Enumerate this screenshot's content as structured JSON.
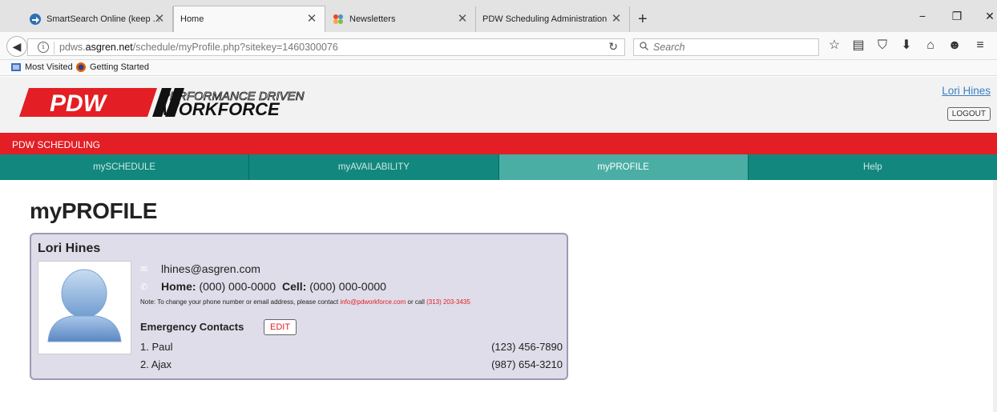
{
  "browser": {
    "tabs": [
      {
        "title": "SmartSearch Online (keep ...",
        "active": false
      },
      {
        "title": "Home",
        "active": true
      },
      {
        "title": "Newsletters",
        "active": false
      },
      {
        "title": "PDW Scheduling Administration",
        "active": false
      }
    ],
    "url_prefix": "pdws.",
    "url_domain": "asgren.net",
    "url_path": "/schedule/myProfile.php?sitekey=1460300076",
    "search_placeholder": "Search",
    "bookmarks": [
      "Most Visited",
      "Getting Started"
    ]
  },
  "header": {
    "logo_text": "PDW",
    "logo_tagline_1": "PERFORMANCE DRIVEN",
    "logo_tagline_2": "WORKFORCE",
    "user_name": "Lori Hines",
    "logout_label": "LOGOUT"
  },
  "app_bar": {
    "title": "PDW SCHEDULING"
  },
  "nav": {
    "items": [
      {
        "label": "mySCHEDULE",
        "active": false
      },
      {
        "label": "myAVAILABILITY",
        "active": false
      },
      {
        "label": "myPROFILE",
        "active": true
      },
      {
        "label": "Help",
        "active": false
      }
    ]
  },
  "page": {
    "title": "myPROFILE"
  },
  "profile": {
    "name": "Lori Hines",
    "email": "lhines@asgren.com",
    "home_label": "Home:",
    "home_phone": "(000) 000-0000",
    "cell_label": "Cell:",
    "cell_phone": "(000) 000-0000",
    "note_prefix": "Note: To change your phone number or email address, please contact ",
    "note_email": "info@pdworkforce.com",
    "note_middle": " or call ",
    "note_phone": "(313) 203-3435",
    "emergency_label": "Emergency Contacts",
    "edit_label": "EDIT",
    "emergency_contacts": [
      {
        "name": "1. Paul",
        "phone": "(123) 456-7890"
      },
      {
        "name": "2. Ajax",
        "phone": "(987) 654-3210"
      }
    ]
  },
  "colors": {
    "brand_red": "#e31e24",
    "nav_teal": "#12877d",
    "nav_active": "#4aaea5",
    "card_bg": "#dedde9"
  }
}
